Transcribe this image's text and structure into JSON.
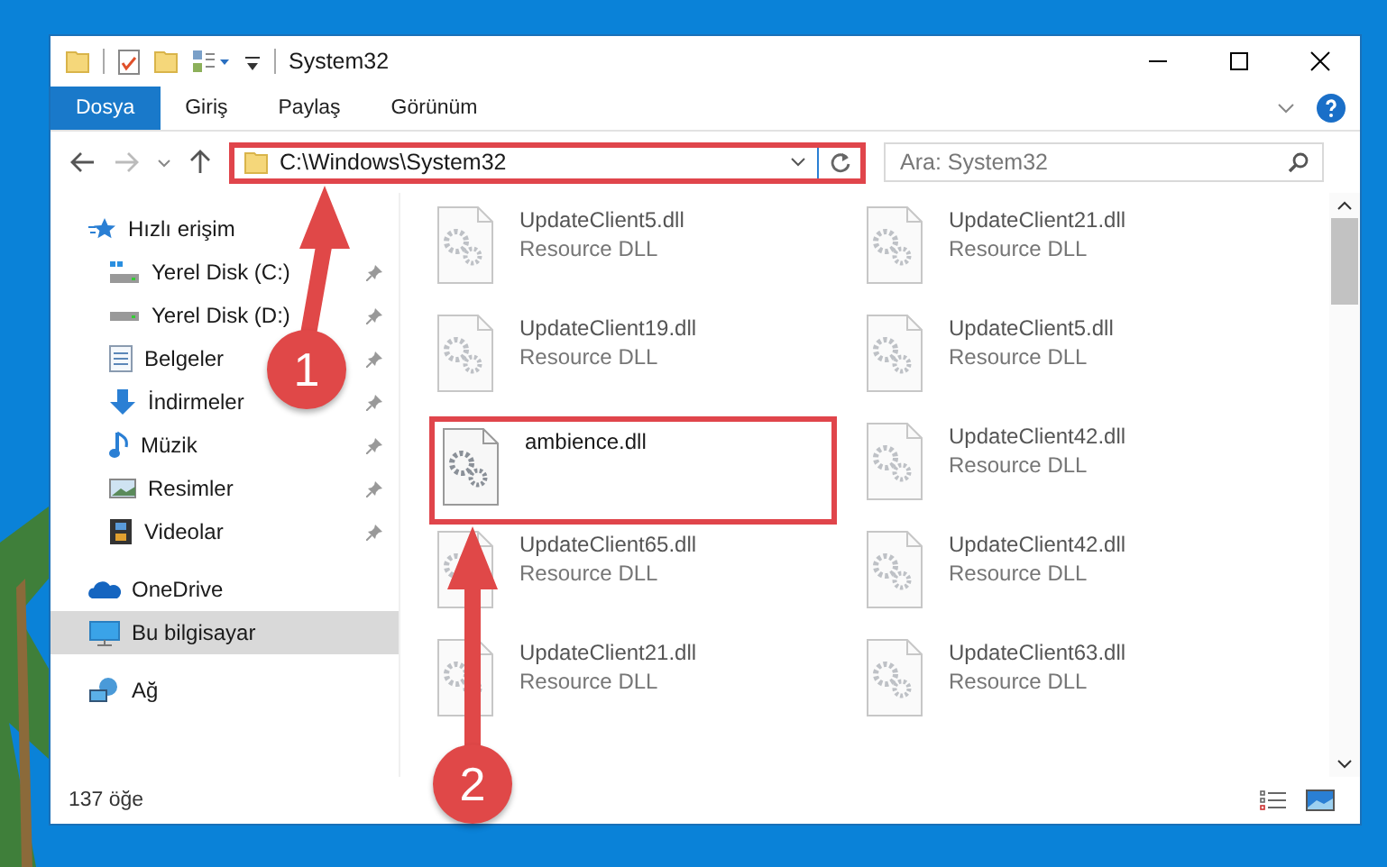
{
  "window": {
    "title": "System32"
  },
  "ribbon_tabs": [
    {
      "label": "Dosya",
      "selected": true
    },
    {
      "label": "Giriş",
      "selected": false
    },
    {
      "label": "Paylaş",
      "selected": false
    },
    {
      "label": "Görünüm",
      "selected": false
    }
  ],
  "address_bar": {
    "path": "C:\\Windows\\System32",
    "highlighted": true
  },
  "search": {
    "placeholder": "Ara: System32"
  },
  "sidebar": {
    "items": [
      {
        "label": "Hızlı erişim",
        "kind": "quick",
        "selected": false,
        "children": [
          {
            "label": "Yerel Disk (C:)",
            "kind": "drive-system",
            "pinned": true,
            "selected": false
          },
          {
            "label": "Yerel Disk (D:)",
            "kind": "drive",
            "pinned": true,
            "selected": false
          },
          {
            "label": "Belgeler",
            "kind": "documents",
            "pinned": true,
            "selected": false
          },
          {
            "label": "İndirmeler",
            "kind": "downloads",
            "pinned": true,
            "selected": false
          },
          {
            "label": "Müzik",
            "kind": "music",
            "pinned": true,
            "selected": false
          },
          {
            "label": "Resimler",
            "kind": "pictures",
            "pinned": true,
            "selected": false
          },
          {
            "label": "Videolar",
            "kind": "videos",
            "pinned": true,
            "selected": false
          }
        ]
      },
      {
        "label": "OneDrive",
        "kind": "cloud",
        "selected": false
      },
      {
        "label": "Bu bilgisayar",
        "kind": "computer",
        "selected": true
      },
      {
        "label": "Ağ",
        "kind": "network",
        "selected": false
      }
    ]
  },
  "files": [
    {
      "name": "UpdateClient5.dll",
      "type": "Resource DLL",
      "blurred": true,
      "highlighted": false
    },
    {
      "name": "UpdateClient21.dll",
      "type": "Resource DLL",
      "blurred": true,
      "highlighted": false
    },
    {
      "name": "UpdateClient19.dll",
      "type": "Resource DLL",
      "blurred": true,
      "highlighted": false
    },
    {
      "name": "UpdateClient5.dll",
      "type": "Resource DLL",
      "blurred": true,
      "highlighted": false
    },
    {
      "name": "ambience.dll",
      "blurred": false,
      "highlighted": true
    },
    {
      "name": "UpdateClient42.dll",
      "type": "Resource DLL",
      "blurred": true,
      "highlighted": false
    },
    {
      "name": "UpdateClient65.dll",
      "type": "Resource DLL",
      "blurred": true,
      "highlighted": false
    },
    {
      "name": "UpdateClient42.dll",
      "type": "Resource DLL",
      "blurred": true,
      "highlighted": false
    },
    {
      "name": "UpdateClient21.dll",
      "type": "Resource DLL",
      "blurred": true,
      "highlighted": false
    },
    {
      "name": "UpdateClient63.dll",
      "type": "Resource DLL",
      "blurred": true,
      "highlighted": false
    }
  ],
  "status_bar": {
    "item_count": "137 öğe"
  },
  "callouts": [
    {
      "number": "1"
    },
    {
      "number": "2"
    }
  ]
}
